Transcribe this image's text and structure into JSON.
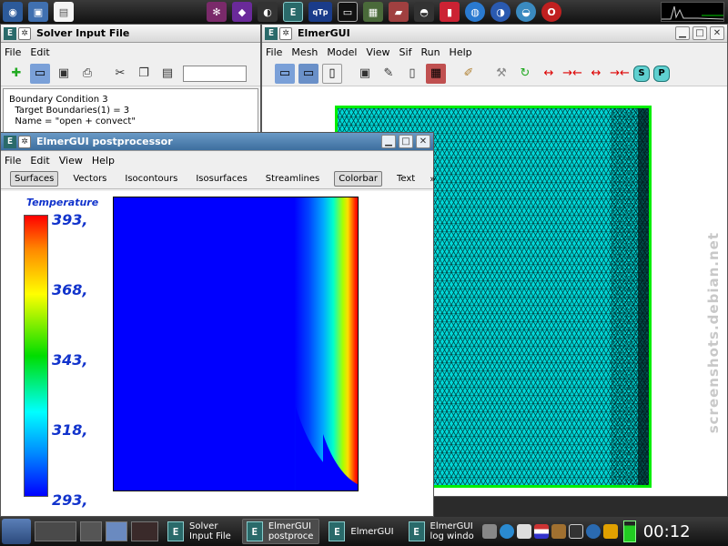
{
  "solver_window": {
    "title": "Solver Input File",
    "menu": [
      "File",
      "Edit"
    ],
    "content": "Boundary Condition 3\n  Target Boundaries(1) = 3\n  Name = \"open + convect\""
  },
  "elmer_window": {
    "title": "ElmerGUI",
    "menu": [
      "File",
      "Mesh",
      "Model",
      "View",
      "Sif",
      "Run",
      "Help"
    ]
  },
  "post_window": {
    "title": "ElmerGUI postprocessor",
    "menu": [
      "File",
      "Edit",
      "View",
      "Help"
    ],
    "tabs": [
      "Surfaces",
      "Vectors",
      "Isocontours",
      "Isosurfaces",
      "Streamlines",
      "Colorbar",
      "Text"
    ],
    "more": "»",
    "colorbar": {
      "title": "Temperature",
      "labels": [
        "393,",
        "368,",
        "343,",
        "318,",
        "293,"
      ]
    }
  },
  "watermark": "screenshots.debian.net",
  "taskbar": {
    "tasks": [
      {
        "line1": "Solver",
        "line2": "Input File"
      },
      {
        "line1": "ElmerGUI",
        "line2": "postproce"
      },
      {
        "line1": "ElmerGUI",
        "line2": ""
      },
      {
        "line1": "ElmerGUI",
        "line2": "log windo"
      }
    ],
    "clock": "00:12"
  },
  "icons": {
    "app_e": "E",
    "qtp": "qTp",
    "toolbar_s": "S",
    "toolbar_p": "P"
  }
}
